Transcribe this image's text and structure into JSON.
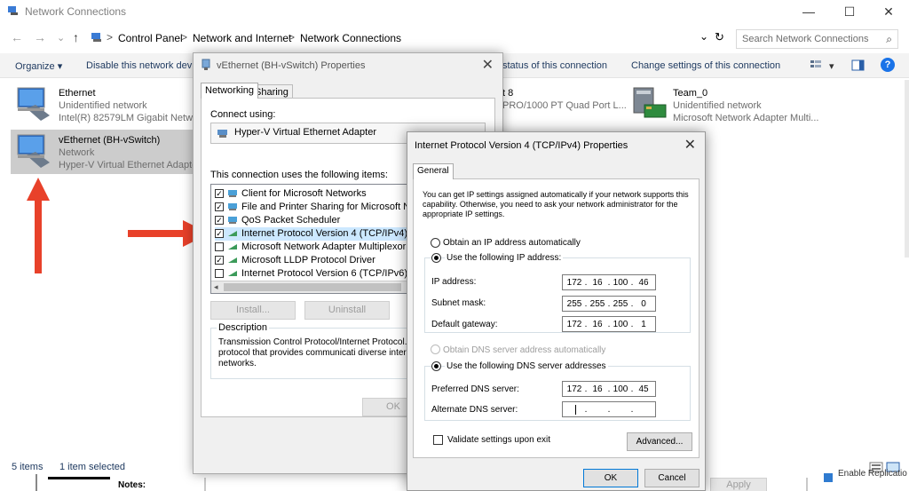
{
  "window": {
    "title": "Network Connections",
    "minimize": "—",
    "maximize": "☐",
    "close": "✕"
  },
  "nav": {
    "back": "←",
    "forward": "→",
    "dropdown": "⌄",
    "up": "↑",
    "refresh": "↻",
    "addr_dropdown": "⌄"
  },
  "breadcrumb": [
    "Control Panel",
    "Network and Internet",
    "Network Connections"
  ],
  "breadcrumb_sep": ">",
  "breadcrumb_lead": ">",
  "search": {
    "placeholder": "Search Network Connections",
    "icon": "⌕"
  },
  "commands": {
    "organize": "Organize ▾",
    "disable": "Disable this network devi",
    "view_status": "status of this connection",
    "change_settings": "Change settings of this connection",
    "view_options": "▾",
    "help": "?"
  },
  "adapters": [
    {
      "name": "Ethernet",
      "status": "Unidentified network",
      "device": "Intel(R) 82579LM Gigabit Netwo"
    },
    {
      "name": "vEthernet (BH-vSwitch)",
      "status": "Network",
      "device": "Hyper-V Virtual Ethernet Adapte"
    },
    {
      "name": "t 8",
      "status": "",
      "device": "PRO/1000 PT Quad Port L..."
    },
    {
      "name": "Team_0",
      "status": "Unidentified network",
      "device": "Microsoft Network Adapter Multi..."
    }
  ],
  "statusbar": {
    "items": "5 items",
    "selected": "1 item selected",
    "notes": "Notes:"
  },
  "background_bits": {
    "enable_replication": "Enable Replicatio",
    "apply": "Apply"
  },
  "props_dialog": {
    "title": "vEthernet (BH-vSwitch) Properties",
    "close": "✕",
    "tabs": [
      "Networking",
      "Sharing"
    ],
    "connect_using_label": "Connect using:",
    "adapter_name": "Hyper-V Virtual Ethernet Adapter",
    "items_label": "This connection uses the following items:",
    "items": [
      {
        "label": "Client for Microsoft Networks",
        "checked": true
      },
      {
        "label": "File and Printer Sharing for Microsoft Networ",
        "checked": true
      },
      {
        "label": "QoS Packet Scheduler",
        "checked": true
      },
      {
        "label": "Internet Protocol Version 4 (TCP/IPv4)",
        "checked": true
      },
      {
        "label": "Microsoft Network Adapter Multiplexor Proto",
        "checked": false
      },
      {
        "label": "Microsoft LLDP Protocol Driver",
        "checked": true
      },
      {
        "label": "Internet Protocol Version 6 (TCP/IPv6)",
        "checked": false
      }
    ],
    "install": "Install...",
    "uninstall": "Uninstall",
    "description_label": "Description",
    "description": "Transmission Control Protocol/Internet Protocol. T area network protocol that provides communicati diverse interconnected networks.",
    "ok": "OK",
    "checkmark": "✓"
  },
  "ipv4_dialog": {
    "title": "Internet Protocol Version 4 (TCP/IPv4) Properties",
    "close": "✕",
    "tab": "General",
    "intro": "You can get IP settings assigned automatically if your network supports this capability. Otherwise, you need to ask your network administrator for the appropriate IP settings.",
    "obtain_ip_auto": "Obtain an IP address automatically",
    "use_following_ip": "Use the following IP address:",
    "ip_label": "IP address:",
    "ip": [
      "172",
      "16",
      "100",
      "46"
    ],
    "subnet_label": "Subnet mask:",
    "subnet": [
      "255",
      "255",
      "255",
      "0"
    ],
    "gateway_label": "Default gateway:",
    "gateway": [
      "172",
      "16",
      "100",
      "1"
    ],
    "obtain_dns_auto": "Obtain DNS server address automatically",
    "use_following_dns": "Use the following DNS server addresses",
    "preferred_dns_label": "Preferred DNS server:",
    "preferred_dns": [
      "172",
      "16",
      "100",
      "45"
    ],
    "alternate_dns_label": "Alternate DNS server:",
    "alternate_dns": [
      "",
      "",
      "",
      ""
    ],
    "ip_dot": ".",
    "validate": "Validate settings upon exit",
    "advanced": "Advanced...",
    "ok": "OK",
    "cancel": "Cancel"
  },
  "colors": {
    "annotation_arrow": "#e8412a",
    "selection": "#cccccc",
    "link": "#1f3a60"
  }
}
